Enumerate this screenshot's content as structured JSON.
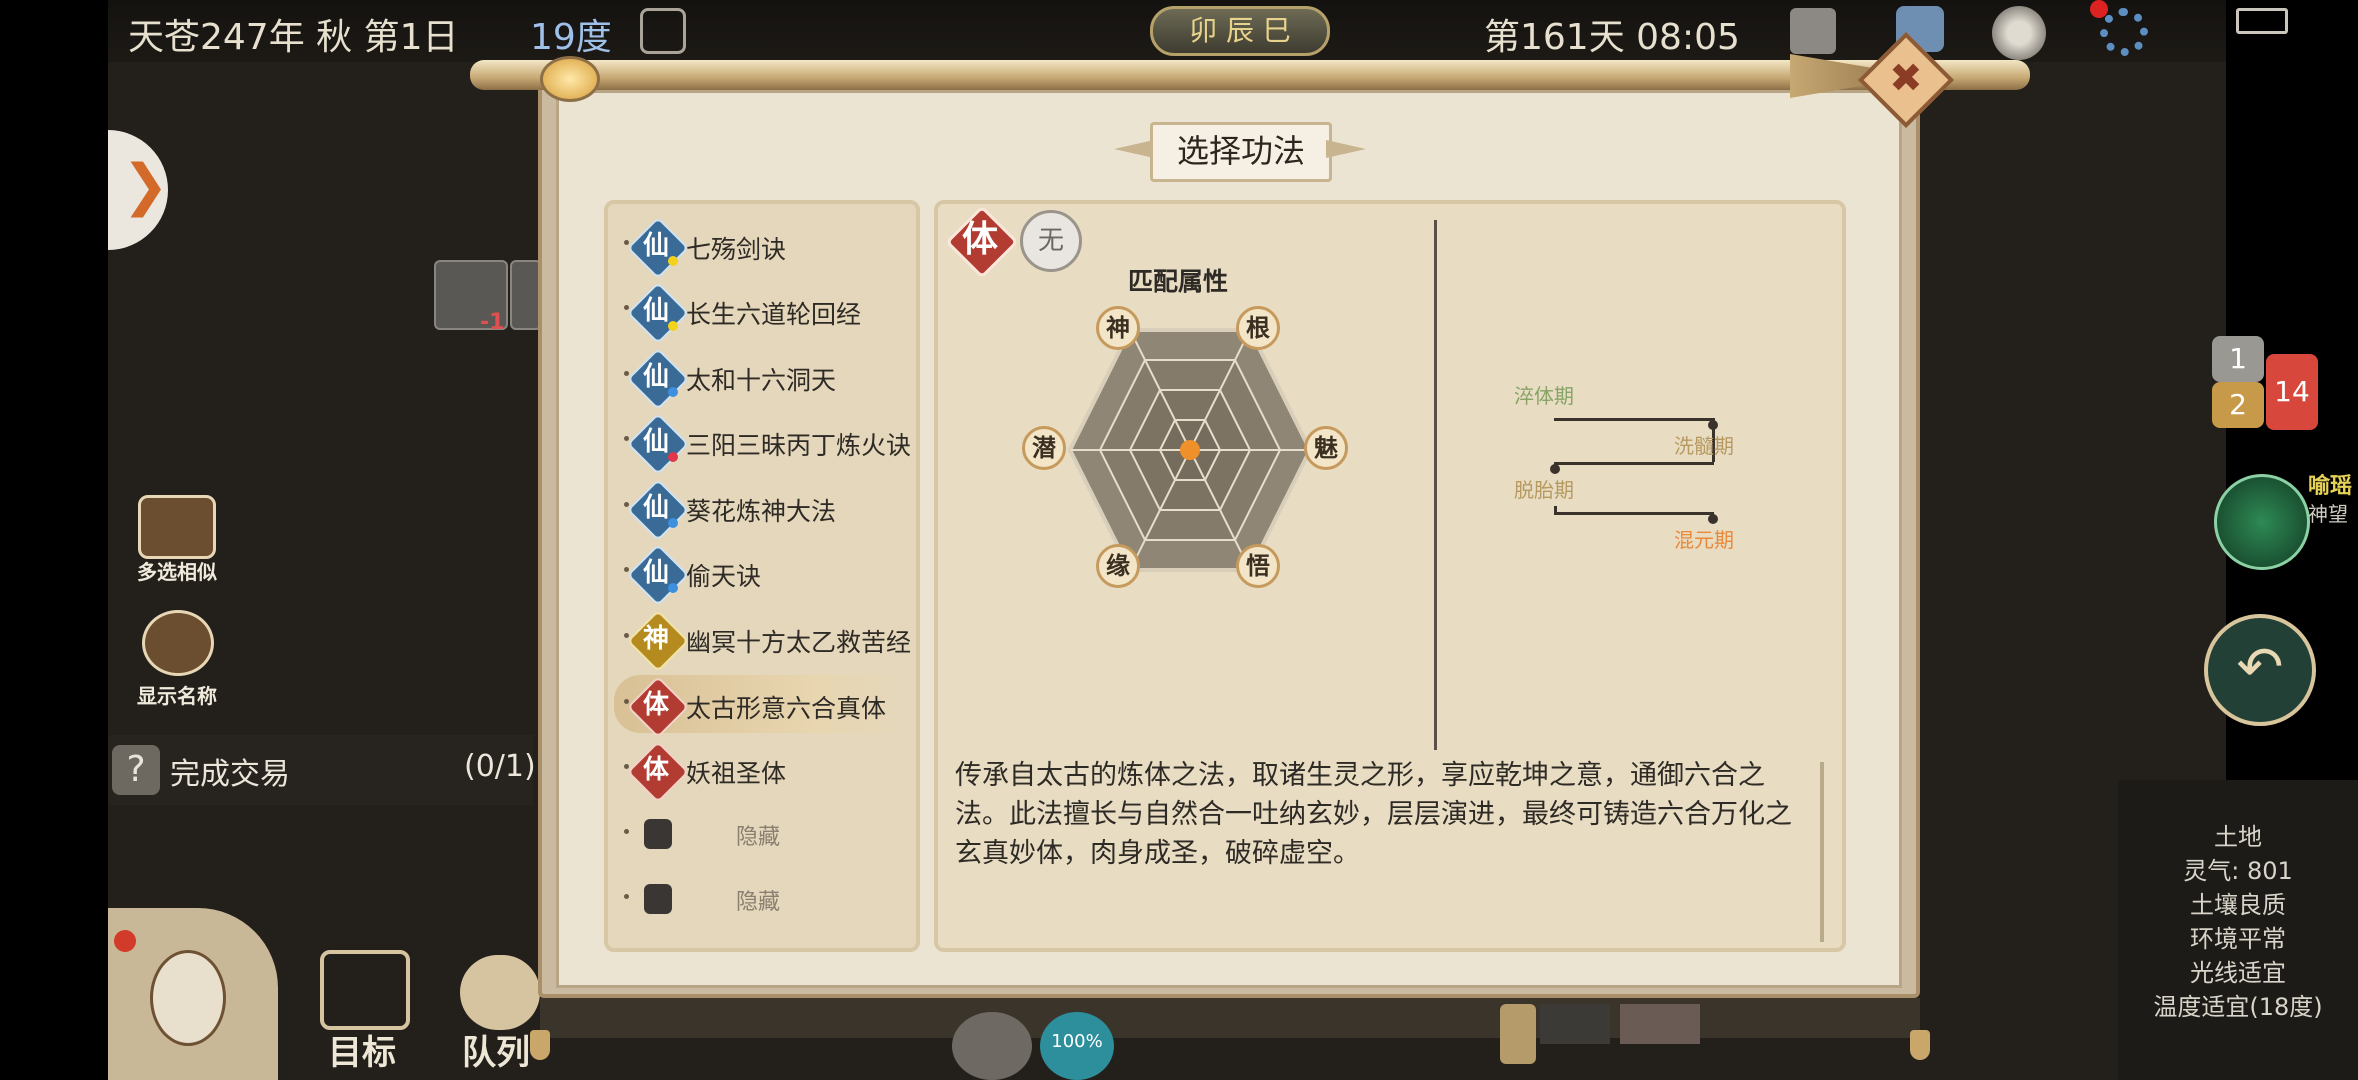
{
  "status_bar": {
    "date": "天苍247年 秋 第1日",
    "temperature": "19度",
    "time_plate": "卯 辰 巳",
    "day_time": "第161天 08:05"
  },
  "left_hud": {
    "multi_select_label": "多选相似",
    "show_name_label": "显示名称",
    "task_icon": "?",
    "task_name": "完成交易",
    "task_progress": "(0/1)",
    "item_count": "-1",
    "target_label": "目标",
    "team_label": "队列"
  },
  "right_hud": {
    "bubble_1": "1",
    "bubble_2": "2",
    "bubble_3": "14",
    "side_text_1": "喻瑶",
    "side_text_2": "神望",
    "land_info": [
      "土地",
      "灵气: 801",
      "土壤良质",
      "环境平常",
      "光线适宜",
      "温度适宜(18度)"
    ],
    "speed": "100%"
  },
  "modal": {
    "title": "选择功法",
    "close_icon": "close-x-icon",
    "techniques": [
      {
        "type": "仙",
        "name": "七殇剑诀",
        "dot_color": "#f3d21b"
      },
      {
        "type": "仙",
        "name": "长生六道轮回经",
        "dot_color": "#f3d21b"
      },
      {
        "type": "仙",
        "name": "太和十六洞天",
        "dot_color": "#3d8fe0"
      },
      {
        "type": "仙",
        "name": "三阳三昧丙丁炼火诀",
        "dot_color": "#e0384a"
      },
      {
        "type": "仙",
        "name": "葵花炼神大法",
        "dot_color": "#3d8fe0"
      },
      {
        "type": "仙",
        "name": "偷天诀",
        "dot_color": "#3d8fe0"
      },
      {
        "type": "神",
        "name": "幽冥十方太乙救苦经",
        "dot_color": ""
      },
      {
        "type": "体",
        "name": "太古形意六合真体",
        "dot_color": "",
        "selected": true
      },
      {
        "type": "体",
        "name": "妖祖圣体",
        "dot_color": ""
      }
    ],
    "locked_items": [
      "隐藏",
      "隐藏"
    ],
    "detail": {
      "type_badge": "体",
      "element_badge": "无",
      "match_title": "匹配属性",
      "attributes": [
        "神",
        "根",
        "魅",
        "悟",
        "缘",
        "潜"
      ],
      "stages": [
        "淬体期",
        "洗髓期",
        "脱胎期",
        "混元期"
      ],
      "description": "传承自太古的炼体之法，取诸生灵之形，享应乾坤之意，通御六合之法。此法擅长与自然合一吐纳玄妙，层层演进，最终可铸造六合万化之玄真妙体，肉身成圣，破碎虚空。"
    }
  },
  "colors": {
    "accent_orange": "#f0902a",
    "body_red": "#b33c32",
    "xian_blue": "#3a6b97",
    "shen_gold": "#b58b1f",
    "stage_green": "#88a366",
    "stage_tan": "#b79a62",
    "stage_orange": "#e88a3a"
  }
}
